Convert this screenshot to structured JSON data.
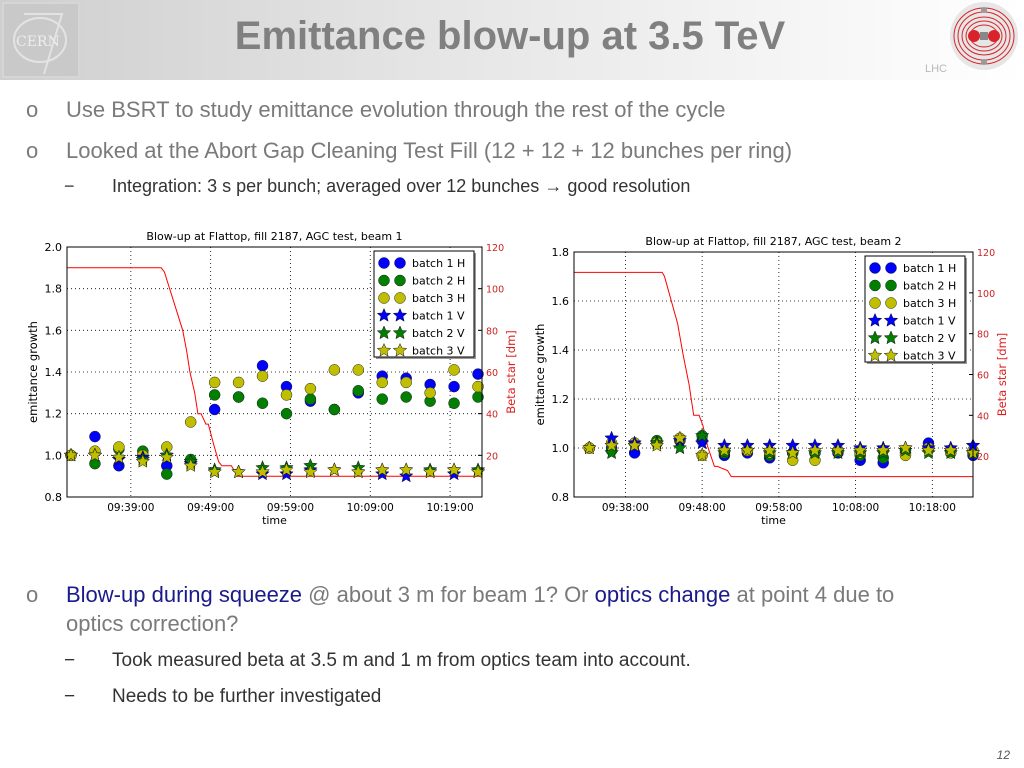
{
  "header": {
    "title": "Emittance blow-up at 3.5 TeV",
    "left_logo": "CERN",
    "right_logo": "LHC"
  },
  "bullets": [
    {
      "mark": "o",
      "text": "Use BSRT to study emittance evolution through the rest of the cycle"
    },
    {
      "mark": "o",
      "text": "Looked at the Abort Gap Cleaning Test Fill (12 + 12 + 12 bunches per ring)"
    }
  ],
  "sub_bullet_1": {
    "mark": "−",
    "text": "Integration: 3 s per bunch; averaged over 12 bunches",
    "arrow": "→",
    "tail": "good resolution"
  },
  "bullet_3": {
    "mark": "o",
    "part1_hl": "Blow-up during squeeze",
    "part2": " @ about 3 m for beam 1? Or ",
    "part3_hl": "optics change",
    "part4": " at point 4 due to",
    "line2": "optics correction?"
  },
  "sub_bullets_2": [
    {
      "mark": "−",
      "text": "Took measured beta at 3.5 m and 1 m from optics team into account."
    },
    {
      "mark": "−",
      "text": "Needs to be further investigated"
    }
  ],
  "page_number": "12",
  "colors": {
    "blue": "#0000ff",
    "green": "#007f00",
    "yellow": "#bfbf00",
    "red": "#ff0000",
    "legend_text": "#000000"
  },
  "chart_data": [
    {
      "type": "scatter",
      "title": "Blow-up at Flattop, fill 2187, AGC test, beam 1",
      "xlabel": "time",
      "ylabel": "emittance growth",
      "y2label": "Beta star [dm]",
      "xlim_minutes": [
        0,
        52
      ],
      "x_ticks": [
        {
          "t": 8,
          "label": "09:39:00"
        },
        {
          "t": 18,
          "label": "09:49:00"
        },
        {
          "t": 28,
          "label": "09:59:00"
        },
        {
          "t": 38,
          "label": "10:09:00"
        },
        {
          "t": 48,
          "label": "10:19:00"
        }
      ],
      "ylim": [
        0.8,
        2.0
      ],
      "y_ticks": [
        "0.8",
        "1.0",
        "1.2",
        "1.4",
        "1.6",
        "1.8",
        "2.0"
      ],
      "y2lim": [
        0,
        120
      ],
      "y2_ticks": [
        "20",
        "40",
        "60",
        "80",
        "100",
        "120"
      ],
      "grid": true,
      "legend": "top-right",
      "x": [
        0.5,
        3.5,
        6.5,
        9.5,
        12.5,
        15.5,
        18.5,
        21.5,
        24.5,
        27.5,
        30.5,
        33.5,
        36.5,
        39.5,
        42.5,
        45.5,
        48.5,
        51.5
      ],
      "series": [
        {
          "name": "batch 1 H",
          "marker": "circle",
          "color": "#0000ff",
          "values": [
            1.0,
            1.09,
            0.95,
            1.0,
            0.95,
            0.97,
            1.22,
            1.28,
            1.43,
            1.33,
            1.26,
            1.22,
            1.3,
            1.38,
            1.37,
            1.34,
            1.33,
            1.39
          ]
        },
        {
          "name": "batch 2 H",
          "marker": "circle",
          "color": "#007f00",
          "values": [
            1.0,
            0.96,
            1.03,
            1.02,
            0.91,
            0.98,
            1.29,
            1.28,
            1.25,
            1.2,
            1.27,
            1.22,
            1.31,
            1.27,
            1.28,
            1.26,
            1.25,
            1.28
          ]
        },
        {
          "name": "batch 3 H",
          "marker": "circle",
          "color": "#bfbf00",
          "values": [
            1.0,
            1.02,
            1.04,
            1.0,
            1.04,
            1.16,
            1.35,
            1.35,
            1.38,
            1.29,
            1.32,
            1.41,
            1.41,
            1.35,
            1.35,
            1.3,
            1.41,
            1.33
          ]
        },
        {
          "name": "batch 1 V",
          "marker": "star",
          "color": "#0000ff",
          "values": [
            1.0,
            1.0,
            0.98,
            0.99,
            1.0,
            0.96,
            0.92,
            0.92,
            0.91,
            0.91,
            0.93,
            0.93,
            0.92,
            0.91,
            0.9,
            0.92,
            0.91,
            0.92
          ]
        },
        {
          "name": "batch 2 V",
          "marker": "star",
          "color": "#007f00",
          "values": [
            1.0,
            1.0,
            0.99,
            0.98,
            1.0,
            0.97,
            0.93,
            0.92,
            0.94,
            0.94,
            0.95,
            0.93,
            0.94,
            0.93,
            0.93,
            0.93,
            0.93,
            0.93
          ]
        },
        {
          "name": "batch 3 V",
          "marker": "star",
          "color": "#bfbf00",
          "values": [
            1.0,
            1.0,
            0.99,
            0.97,
            0.99,
            0.95,
            0.92,
            0.92,
            0.92,
            0.93,
            0.92,
            0.93,
            0.92,
            0.93,
            0.93,
            0.92,
            0.93,
            0.92
          ]
        }
      ],
      "beta_star": {
        "name": "Beta star [dm]",
        "color": "#ff0000",
        "axis": "right",
        "t": [
          0,
          11.8,
          12.2,
          14.5,
          15.0,
          15.4,
          16.0,
          16.4,
          16.8,
          17.4,
          17.7,
          18.4,
          19.0,
          19.4,
          20.6,
          20.9,
          21.3,
          52
        ],
        "v": [
          110,
          110,
          108,
          80,
          70,
          60,
          50,
          40,
          40,
          35,
          35,
          25,
          17,
          15,
          15,
          13,
          10,
          10
        ]
      }
    },
    {
      "type": "scatter",
      "title": "Blow-up at Flattop, fill 2187, AGC test, beam 2",
      "xlabel": "time",
      "ylabel": "emittance growth",
      "y2label": "Beta star [dm]",
      "xlim_minutes": [
        0,
        52
      ],
      "x_ticks": [
        {
          "t": 6.7,
          "label": "09:38:00"
        },
        {
          "t": 16.7,
          "label": "09:48:00"
        },
        {
          "t": 26.7,
          "label": "09:58:00"
        },
        {
          "t": 36.7,
          "label": "10:08:00"
        },
        {
          "t": 46.7,
          "label": "10:18:00"
        }
      ],
      "ylim": [
        0.8,
        1.8
      ],
      "y_ticks": [
        "0.8",
        "1.0",
        "1.2",
        "1.4",
        "1.6",
        "1.8"
      ],
      "y2lim": [
        0,
        120
      ],
      "y2_ticks": [
        "20",
        "40",
        "60",
        "80",
        "100",
        "120"
      ],
      "grid": true,
      "legend": "top-right",
      "x": [
        2.0,
        4.9,
        7.9,
        10.8,
        13.8,
        16.7,
        19.6,
        22.6,
        25.5,
        28.5,
        31.4,
        34.4,
        37.3,
        40.3,
        43.2,
        46.2,
        49.1,
        52.0
      ],
      "series": [
        {
          "name": "batch 1 H",
          "marker": "circle",
          "color": "#0000ff",
          "values": [
            1.0,
            1.0,
            0.98,
            1.02,
            1.03,
            1.03,
            0.97,
            0.98,
            0.96,
            0.98,
            0.98,
            0.98,
            0.95,
            0.94,
            0.98,
            1.02,
            0.99,
            0.97
          ]
        },
        {
          "name": "batch 2 H",
          "marker": "circle",
          "color": "#007f00",
          "values": [
            1.0,
            0.99,
            1.02,
            1.03,
            1.03,
            1.05,
            0.98,
            0.99,
            0.97,
            0.98,
            0.98,
            0.99,
            0.97,
            0.96,
            0.99,
            1.0,
            0.99,
            0.98
          ]
        },
        {
          "name": "batch 3 H",
          "marker": "circle",
          "color": "#bfbf00",
          "values": [
            1.0,
            1.02,
            1.02,
            1.02,
            1.04,
            0.97,
            0.99,
            0.99,
            0.98,
            0.95,
            0.95,
            0.99,
            0.98,
            0.99,
            0.97,
            1.0,
            0.98,
            0.99
          ]
        },
        {
          "name": "batch 1 V",
          "marker": "star",
          "color": "#0000ff",
          "values": [
            1.0,
            1.04,
            1.02,
            1.02,
            1.03,
            1.02,
            1.01,
            1.01,
            1.01,
            1.01,
            1.01,
            1.01,
            1.0,
            1.0,
            1.0,
            1.0,
            1.0,
            1.01
          ]
        },
        {
          "name": "batch 2 V",
          "marker": "star",
          "color": "#007f00",
          "values": [
            1.0,
            0.98,
            1.01,
            1.02,
            1.0,
            1.05,
            0.98,
            0.99,
            0.98,
            0.98,
            0.98,
            0.98,
            0.98,
            0.98,
            0.99,
            0.98,
            0.98,
            0.98
          ]
        },
        {
          "name": "batch 3 V",
          "marker": "star",
          "color": "#bfbf00",
          "values": [
            1.0,
            1.01,
            1.01,
            1.01,
            1.04,
            0.97,
            0.99,
            0.99,
            0.99,
            0.98,
            0.99,
            0.99,
            0.99,
            0.99,
            1.0,
            0.99,
            0.99,
            0.98
          ]
        }
      ],
      "beta_star": {
        "name": "Beta star [dm]",
        "color": "#ff0000",
        "axis": "right",
        "t": [
          0,
          11.5,
          11.8,
          13.5,
          14.2,
          15.0,
          15.6,
          16.3,
          16.8,
          17.4,
          18.3,
          18.7,
          19.3,
          20.0,
          20.5,
          52
        ],
        "v": [
          110,
          110,
          108,
          85,
          70,
          55,
          40,
          40,
          35,
          25,
          15,
          15,
          14,
          13,
          10,
          10
        ]
      }
    }
  ]
}
